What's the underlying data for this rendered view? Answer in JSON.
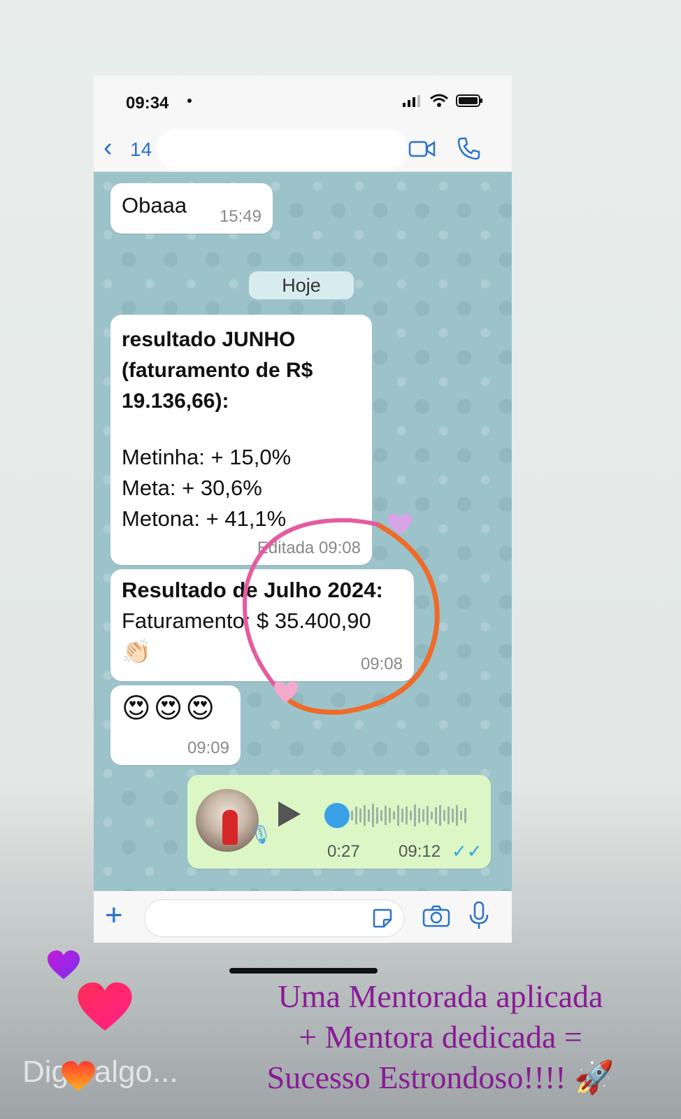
{
  "status_bar": {
    "time": "09:34"
  },
  "header": {
    "contact_partial": "14"
  },
  "chat": {
    "messages": [
      {
        "text": "Obaaa",
        "time": "15:49"
      },
      {
        "heading_lines": [
          "resultado JUNHO",
          "(faturamento de R$",
          "19.136,66):"
        ],
        "lines": [
          "Metinha: + 15,0%",
          "Meta: + 30,6%",
          "Metona: + 41,1%"
        ],
        "time": "Editada 09:08"
      },
      {
        "heading": "Resultado de Julho 2024:",
        "text": "Faturamento: $ 35.400,90",
        "emoji": "👏🏻",
        "time": "09:08"
      },
      {
        "emoji": "😍😍😍",
        "time": "09:09"
      }
    ],
    "day_separator": "Hoje",
    "audio": {
      "duration": "0:27",
      "time": "09:12",
      "ticks": "✓✓",
      "progress": 0
    }
  },
  "overlay": {
    "caption_lines": [
      "Uma Mentorada aplicada",
      "+ Mentora dedicada =",
      "Sucesso Estrondoso!!!! 🚀"
    ],
    "reply_placeholder": "Diga algo..."
  },
  "colors": {
    "accent_blue": "#2a72c8",
    "caption_purple": "#8a1a96",
    "chat_bg": "#9cc3c9",
    "audio_bubble": "#dcf7c5"
  }
}
